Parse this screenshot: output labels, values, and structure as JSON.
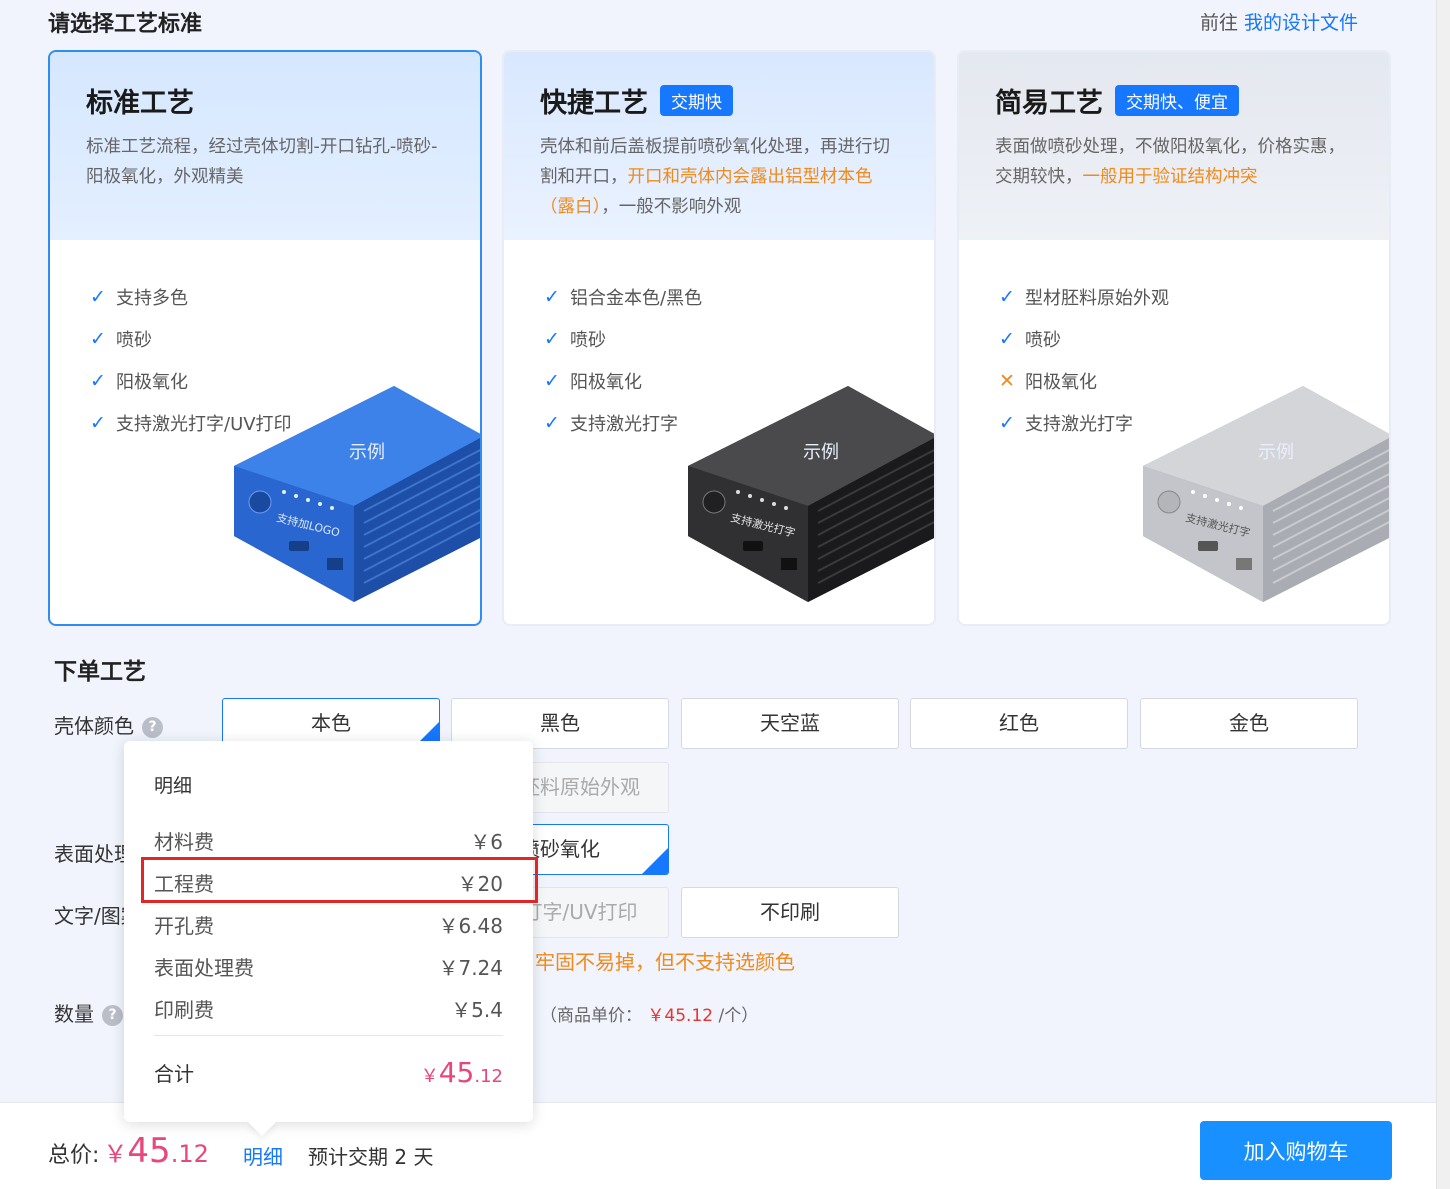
{
  "header": {
    "title": "请选择工艺标准",
    "goto_prefix": "前往",
    "goto_link": "我的设计文件"
  },
  "cards": [
    {
      "title": "标准工艺",
      "tag": "",
      "desc_parts": [
        "标准工艺流程，经过壳体切割-开口钻孔-喷砂-阳极氧化，外观精美"
      ],
      "features": [
        {
          "mark": "check",
          "text": "支持多色"
        },
        {
          "mark": "check",
          "text": "喷砂"
        },
        {
          "mark": "check",
          "text": "阳极氧化"
        },
        {
          "mark": "check",
          "text": "支持激光打字/UV打印"
        }
      ],
      "example_label": "示例",
      "product_color": "#2f6fd6",
      "product_text": "支持加LOGO",
      "selected": true
    },
    {
      "title": "快捷工艺",
      "tag": "交期快",
      "desc_plain": "壳体和前后盖板提前喷砂氧化处理，再进行切割和开口，",
      "desc_highlight": "开口和壳体内会露出铝型材本色（露白）",
      "desc_tail": "，一般不影响外观",
      "features": [
        {
          "mark": "check",
          "text": "铝合金本色/黑色"
        },
        {
          "mark": "check",
          "text": "喷砂"
        },
        {
          "mark": "check",
          "text": "阳极氧化"
        },
        {
          "mark": "check",
          "text": "支持激光打字"
        }
      ],
      "example_label": "示例",
      "product_color": "#2a2a2c",
      "product_text": "支持激光打字",
      "selected": false
    },
    {
      "title": "简易工艺",
      "tag": "交期快、便宜",
      "desc_plain": "表面做喷砂处理，不做阳极氧化，价格实惠，交期较快，",
      "desc_highlight": "一般用于验证结构冲突",
      "desc_tail": "",
      "features": [
        {
          "mark": "check",
          "text": "型材胚料原始外观"
        },
        {
          "mark": "check",
          "text": "喷砂"
        },
        {
          "mark": "cross",
          "text": "阳极氧化"
        },
        {
          "mark": "check",
          "text": "支持激光打字"
        }
      ],
      "example_label": "示例",
      "product_color": "#b9bcc2",
      "product_text": "支持激光打字",
      "selected": false
    }
  ],
  "order": {
    "section_title": "下单工艺",
    "shell_color_label": "壳体颜色",
    "help_icon": "?",
    "colors": [
      "本色",
      "黑色",
      "天空蓝",
      "红色",
      "金色"
    ],
    "surface_label": "表面处理",
    "surface_options": [
      "型材胚料原始外观",
      "喷砂氧化"
    ],
    "print_label": "文字/图案",
    "print_options": [
      "激光打字/UV打印",
      "不印刷"
    ],
    "print_note": "牢固不易掉，但不支持选颜色",
    "qty_label": "数量",
    "unit_price_prefix": "（商品单价：",
    "unit_price": "￥45.12",
    "unit_price_suffix": "/个）"
  },
  "popup": {
    "title": "明细",
    "rows": [
      {
        "name": "材料费",
        "value": "￥6"
      },
      {
        "name": "工程费",
        "value": "￥20"
      },
      {
        "name": "开孔费",
        "value": "￥6.48"
      },
      {
        "name": "表面处理费",
        "value": "￥7.24"
      },
      {
        "name": "印刷费",
        "value": "￥5.4"
      }
    ],
    "total_label": "合计",
    "total_currency": "￥",
    "total_int": "45",
    "total_dec": ".12"
  },
  "footer": {
    "total_label": "总价:",
    "total_currency": "￥",
    "total_int": "45",
    "total_dec": ".12",
    "detail_link": "明细",
    "eta": "预计交期 2 天",
    "cart_button": "加入购物车"
  },
  "colors": {
    "accent": "#1677ff",
    "highlight": "#f08a1c",
    "price": "#e8467d",
    "red_box": "#e02626"
  }
}
